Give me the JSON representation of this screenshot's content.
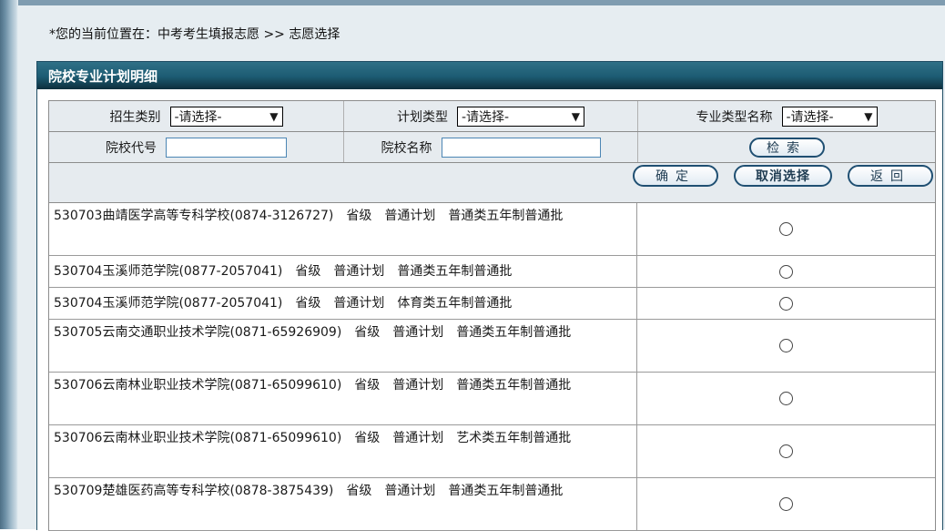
{
  "breadcrumb": "*您的当前位置在：中考考生填报志愿 >> 志愿选择",
  "panel_title": "院校专业计划明细",
  "filters": {
    "enroll_category_label": "招生类别",
    "enroll_category_value": "-请选择-",
    "plan_type_label": "计划类型",
    "plan_type_value": "-请选择-",
    "major_type_label": "专业类型名称",
    "major_type_value": "-请选择-",
    "school_code_label": "院校代号",
    "school_code_value": "",
    "school_name_label": "院校名称",
    "school_name_value": "",
    "search_button": "检索"
  },
  "actions": {
    "confirm": "确定",
    "cancel_selection": "取消选择",
    "back": "返回"
  },
  "rows": [
    {
      "text": "530703曲靖医学高等专科学校(0874-3126727)　省级　普通计划　普通类五年制普通批",
      "selected": false
    },
    {
      "text": "530704玉溪师范学院(0877-2057041)　省级　普通计划　普通类五年制普通批",
      "selected": false
    },
    {
      "text": "530704玉溪师范学院(0877-2057041)　省级　普通计划　体育类五年制普通批",
      "selected": false
    },
    {
      "text": "530705云南交通职业技术学院(0871-65926909)　省级　普通计划　普通类五年制普通批",
      "selected": false
    },
    {
      "text": "530706云南林业职业技术学院(0871-65099610)　省级　普通计划　普通类五年制普通批",
      "selected": false
    },
    {
      "text": "530706云南林业职业技术学院(0871-65099610)　省级　普通计划　艺术类五年制普通批",
      "selected": false
    },
    {
      "text": "530709楚雄医药高等专科学校(0878-3875439)　省级　普通计划　普通类五年制普通批",
      "selected": false
    }
  ]
}
